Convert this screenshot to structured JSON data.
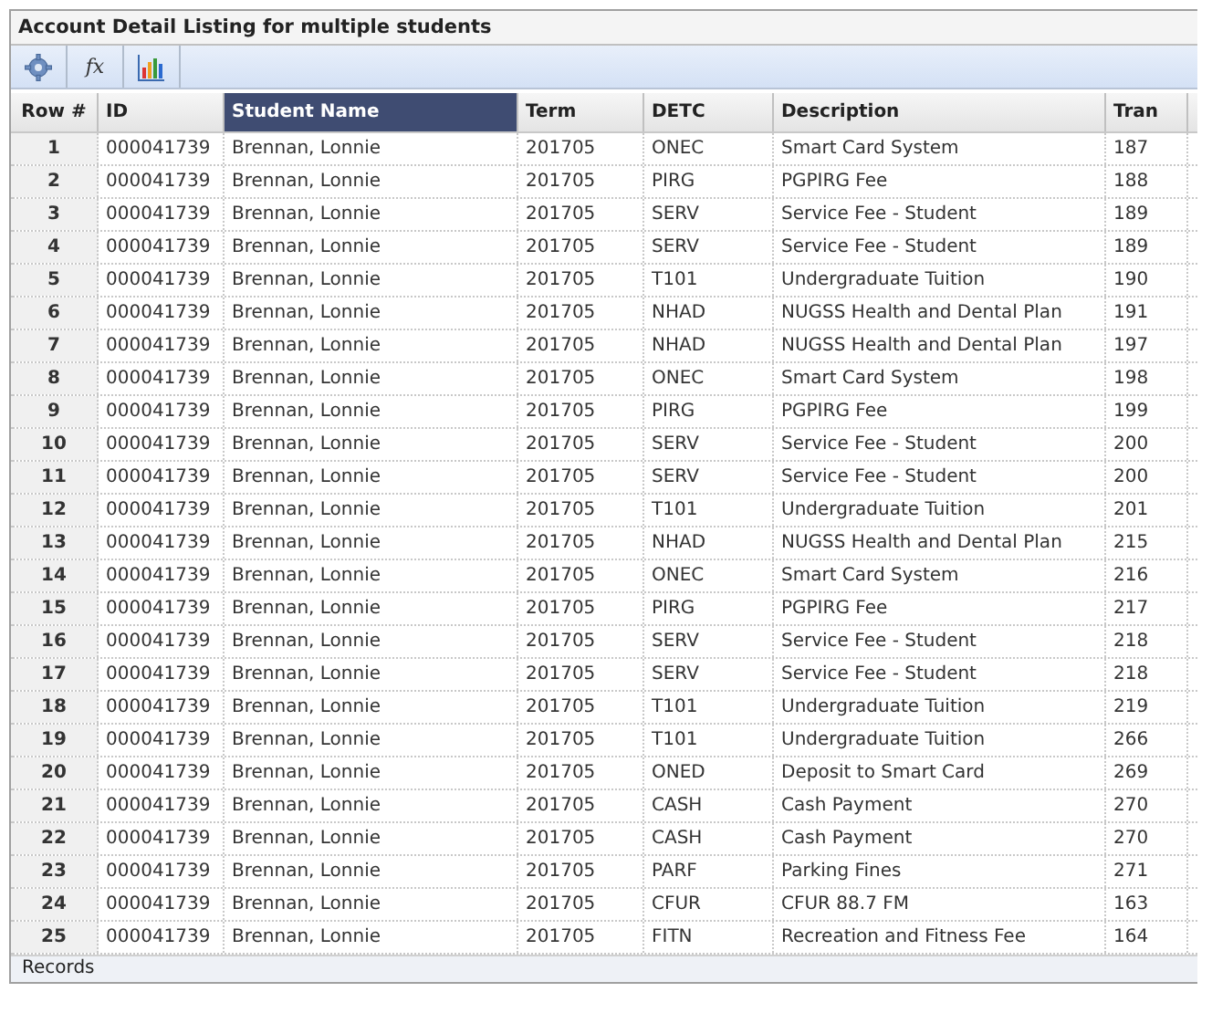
{
  "window": {
    "title": "Account Detail Listing for multiple students"
  },
  "toolbar": {
    "buttons": [
      {
        "kind": "gear"
      },
      {
        "kind": "fx",
        "label": "fx"
      },
      {
        "kind": "chart"
      }
    ]
  },
  "table": {
    "columns": [
      {
        "label": "Row #",
        "selected": false
      },
      {
        "label": "ID",
        "selected": false
      },
      {
        "label": "Student Name",
        "selected": true
      },
      {
        "label": "Term",
        "selected": false
      },
      {
        "label": "DETC",
        "selected": false
      },
      {
        "label": "Description",
        "selected": false
      },
      {
        "label": "Tran",
        "selected": false
      }
    ],
    "rows": [
      [
        "1",
        "000041739",
        "Brennan, Lonnie",
        "201705",
        "ONEC",
        "Smart Card System",
        "187"
      ],
      [
        "2",
        "000041739",
        "Brennan, Lonnie",
        "201705",
        "PIRG",
        "PGPIRG Fee",
        "188"
      ],
      [
        "3",
        "000041739",
        "Brennan, Lonnie",
        "201705",
        "SERV",
        "Service Fee - Student",
        "189"
      ],
      [
        "4",
        "000041739",
        "Brennan, Lonnie",
        "201705",
        "SERV",
        "Service Fee - Student",
        "189"
      ],
      [
        "5",
        "000041739",
        "Brennan, Lonnie",
        "201705",
        "T101",
        "Undergraduate Tuition",
        "190"
      ],
      [
        "6",
        "000041739",
        "Brennan, Lonnie",
        "201705",
        "NHAD",
        "NUGSS Health and Dental Plan",
        "191"
      ],
      [
        "7",
        "000041739",
        "Brennan, Lonnie",
        "201705",
        "NHAD",
        "NUGSS Health and Dental Plan",
        "197"
      ],
      [
        "8",
        "000041739",
        "Brennan, Lonnie",
        "201705",
        "ONEC",
        "Smart Card System",
        "198"
      ],
      [
        "9",
        "000041739",
        "Brennan, Lonnie",
        "201705",
        "PIRG",
        "PGPIRG Fee",
        "199"
      ],
      [
        "10",
        "000041739",
        "Brennan, Lonnie",
        "201705",
        "SERV",
        "Service Fee - Student",
        "200"
      ],
      [
        "11",
        "000041739",
        "Brennan, Lonnie",
        "201705",
        "SERV",
        "Service Fee - Student",
        "200"
      ],
      [
        "12",
        "000041739",
        "Brennan, Lonnie",
        "201705",
        "T101",
        "Undergraduate Tuition",
        "201"
      ],
      [
        "13",
        "000041739",
        "Brennan, Lonnie",
        "201705",
        "NHAD",
        "NUGSS Health and Dental Plan",
        "215"
      ],
      [
        "14",
        "000041739",
        "Brennan, Lonnie",
        "201705",
        "ONEC",
        "Smart Card System",
        "216"
      ],
      [
        "15",
        "000041739",
        "Brennan, Lonnie",
        "201705",
        "PIRG",
        "PGPIRG Fee",
        "217"
      ],
      [
        "16",
        "000041739",
        "Brennan, Lonnie",
        "201705",
        "SERV",
        "Service Fee - Student",
        "218"
      ],
      [
        "17",
        "000041739",
        "Brennan, Lonnie",
        "201705",
        "SERV",
        "Service Fee - Student",
        "218"
      ],
      [
        "18",
        "000041739",
        "Brennan, Lonnie",
        "201705",
        "T101",
        "Undergraduate Tuition",
        "219"
      ],
      [
        "19",
        "000041739",
        "Brennan, Lonnie",
        "201705",
        "T101",
        "Undergraduate Tuition",
        "266"
      ],
      [
        "20",
        "000041739",
        "Brennan, Lonnie",
        "201705",
        "ONED",
        "Deposit to Smart Card",
        "269"
      ],
      [
        "21",
        "000041739",
        "Brennan, Lonnie",
        "201705",
        "CASH",
        "Cash Payment",
        "270"
      ],
      [
        "22",
        "000041739",
        "Brennan, Lonnie",
        "201705",
        "CASH",
        "Cash Payment",
        "270"
      ],
      [
        "23",
        "000041739",
        "Brennan, Lonnie",
        "201705",
        "PARF",
        "Parking Fines",
        "271"
      ],
      [
        "24",
        "000041739",
        "Brennan, Lonnie",
        "201705",
        "CFUR",
        "CFUR 88.7 FM",
        "163"
      ],
      [
        "25",
        "000041739",
        "Brennan, Lonnie",
        "201705",
        "FITN",
        "Recreation and Fitness Fee",
        "164"
      ]
    ]
  },
  "status_bar": {
    "text": "Records"
  }
}
